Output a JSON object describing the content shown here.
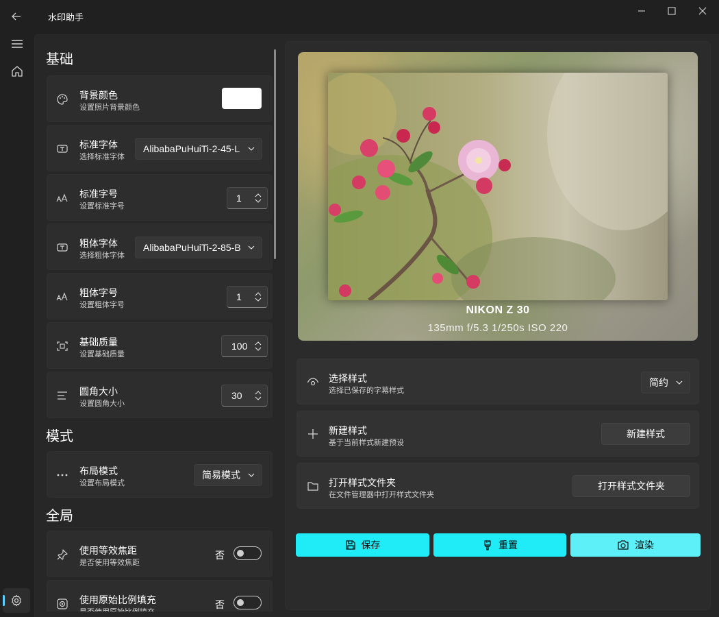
{
  "app": {
    "title": "水印助手"
  },
  "left": {
    "sections": {
      "basic": "基础",
      "mode": "模式",
      "global": "全局"
    },
    "bg_color": {
      "label": "背景颜色",
      "desc": "设置照片背景颜色",
      "value": "#ffffff"
    },
    "std_font": {
      "label": "标准字体",
      "desc": "选择标准字体",
      "value": "AlibabaPuHuiTi-2-45-L"
    },
    "std_size": {
      "label": "标准字号",
      "desc": "设置标准字号",
      "value": "1"
    },
    "bold_font": {
      "label": "粗体字体",
      "desc": "选择粗体字体",
      "value": "AlibabaPuHuiTi-2-85-B"
    },
    "bold_size": {
      "label": "粗体字号",
      "desc": "设置粗体字号",
      "value": "1"
    },
    "quality": {
      "label": "基础质量",
      "desc": "设置基础质量",
      "value": "100"
    },
    "radius": {
      "label": "圆角大小",
      "desc": "设置圆角大小",
      "value": "30"
    },
    "layout": {
      "label": "布局模式",
      "desc": "设置布局模式",
      "value": "简易模式"
    },
    "equiv_focal": {
      "label": "使用等效焦距",
      "desc": "是否使用等效焦距",
      "state": "否"
    },
    "orig_ratio": {
      "label": "使用原始比例填充",
      "desc": "是否使用原始比例填充",
      "state": "否"
    }
  },
  "preview": {
    "camera_model": "NIKON Z 30",
    "params": "135mm  f/5.3  1/250s  ISO 220"
  },
  "right": {
    "select_style": {
      "label": "选择样式",
      "desc": "选择已保存的字幕样式",
      "value": "简约"
    },
    "new_style": {
      "label": "新建样式",
      "desc": "基于当前样式新建预设",
      "button": "新建样式"
    },
    "open_folder": {
      "label": "打开样式文件夹",
      "desc": "在文件管理器中打开样式文件夹",
      "button": "打开样式文件夹"
    }
  },
  "actions": {
    "save": "保存",
    "reset": "重置",
    "render": "渲染"
  },
  "colors": {
    "accent": "#20ecf8",
    "window_bg": "#202020",
    "card_bg": "#2d2d2d"
  }
}
